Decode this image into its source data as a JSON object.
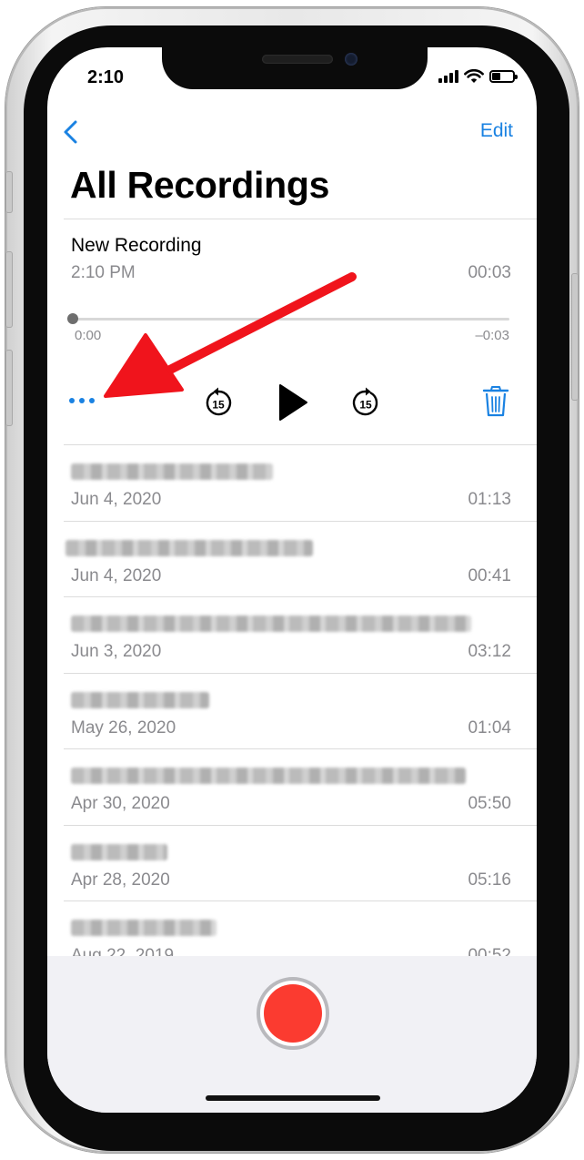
{
  "status_bar": {
    "time": "2:10"
  },
  "nav": {
    "edit_label": "Edit"
  },
  "page": {
    "title": "All Recordings"
  },
  "current_recording": {
    "name": "New Recording",
    "date": "2:10 PM",
    "duration": "00:03",
    "elapsed": "0:00",
    "remaining": "–0:03",
    "skip_seconds": "15"
  },
  "recordings": [
    {
      "title_hidden": true,
      "date": "Jun 4, 2020",
      "duration": "01:13"
    },
    {
      "title_hidden": true,
      "date": "Jun 4, 2020",
      "duration": "00:41"
    },
    {
      "title_hidden": true,
      "date": "Jun 3, 2020",
      "duration": "03:12"
    },
    {
      "title_hidden": true,
      "date": "May 26, 2020",
      "duration": "01:04"
    },
    {
      "title_hidden": true,
      "date": "Apr 30, 2020",
      "duration": "05:50"
    },
    {
      "title_hidden": true,
      "date": "Apr 28, 2020",
      "duration": "05:16"
    },
    {
      "title_hidden": true,
      "date": "Aug 22, 2019",
      "duration": "00:52"
    }
  ],
  "colors": {
    "accent": "#1a82e2",
    "record": "#fb3b30",
    "annotation_arrow": "#f0141c",
    "secondary_text": "#8a8a8e"
  },
  "icons": {
    "back": "chevron-left-icon",
    "more": "more-dots-icon",
    "skip_back": "skip-back-15-icon",
    "play": "play-icon",
    "skip_forward": "skip-forward-15-icon",
    "delete": "trash-icon",
    "record": "record-icon"
  }
}
